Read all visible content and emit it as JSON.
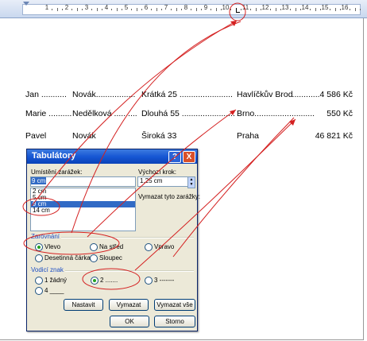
{
  "ruler": {
    "numbers": [
      "1",
      "2",
      "3",
      "4",
      "5",
      "6",
      "7",
      "8",
      "9",
      "10",
      "11",
      "12",
      "13",
      "14",
      "15",
      "16"
    ]
  },
  "document": {
    "rows": [
      {
        "c1": "Jan ...........",
        "c2": "Novák.................",
        "c3": "Krátká 25 .......................",
        "c4": "Havlíčkův Brod",
        "c5": "............4 586 Kč"
      },
      {
        "c1": "Marie ..........",
        "c2": "Nedělková ..........",
        "c3": "Dlouhá 55 .......................",
        "c4": "Brno..........................",
        "c5": "550 Kč"
      },
      {
        "c1": "Pavel",
        "c2": "Novák",
        "c3": "Široká 33",
        "c4": "Praha",
        "c5": "46 821 Kč"
      }
    ]
  },
  "dialog": {
    "title": "Tabulátory",
    "help_glyph": "?",
    "close_glyph": "X",
    "tab_position_label": "Umístění zarážek:",
    "tab_position_value": "9 cm",
    "tab_list": [
      "2 cm",
      "5 cm",
      "9 cm",
      "14 cm"
    ],
    "default_step_label": "Výchozí krok:",
    "default_step_value": "1,25 cm",
    "clear_label": "Vymazat tyto zarážky:",
    "alignment_group": "Zarovnání",
    "alignment": {
      "left": "Vlevo",
      "center": "Na střed",
      "right": "Vpravo",
      "decimal": "Desetinná čárka",
      "bar": "Sloupec"
    },
    "leader_group": "Vodicí znak",
    "leader": {
      "none": "1 žádný",
      "dots": "2 .......",
      "dashes": "3 -------",
      "line": "4 ____"
    },
    "buttons": {
      "set": "Nastavit",
      "clear": "Vymazat",
      "clear_all": "Vymazat vše",
      "ok": "OK",
      "cancel": "Storno"
    }
  },
  "colors": {
    "annotation": "#d42020",
    "selection": "#316ac5",
    "title_bar": "#1757d4"
  }
}
